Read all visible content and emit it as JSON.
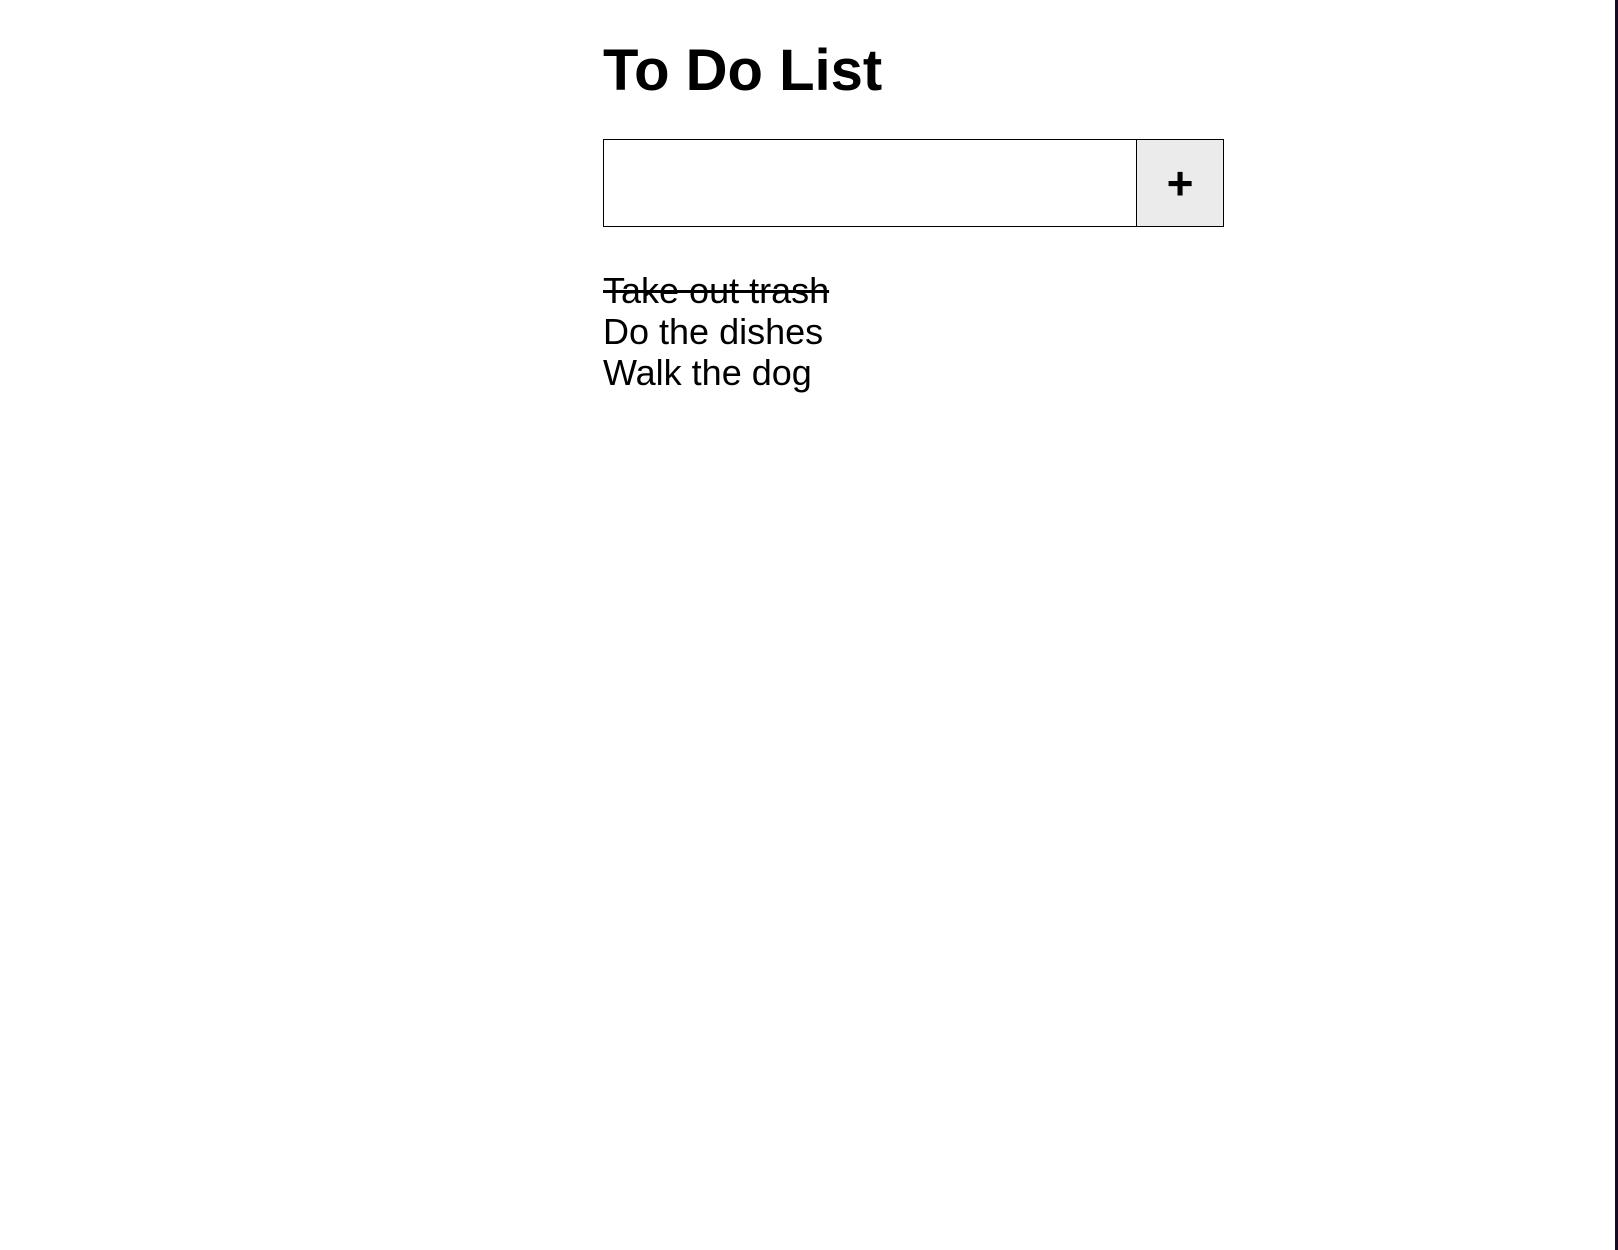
{
  "title": "To Do List",
  "input": {
    "value": "",
    "placeholder": ""
  },
  "add_button_label": "+",
  "items": [
    {
      "text": "Take out trash",
      "completed": true
    },
    {
      "text": "Do the dishes",
      "completed": false
    },
    {
      "text": "Walk the dog",
      "completed": false
    }
  ]
}
